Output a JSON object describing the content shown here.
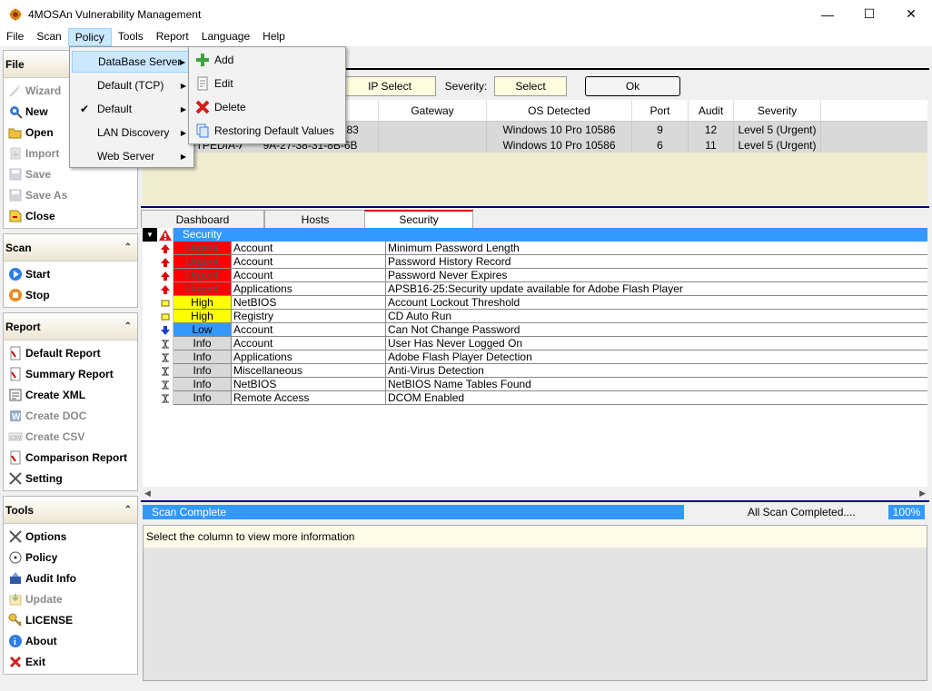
{
  "window": {
    "title": "4MOSAn Vulnerability Management"
  },
  "menubar": [
    "File",
    "Scan",
    "Policy",
    "Tools",
    "Report",
    "Language",
    "Help"
  ],
  "sidebar": {
    "file": {
      "title": "File",
      "items": [
        {
          "label": "Wizard",
          "icon": "wizard-icon",
          "enabled": false
        },
        {
          "label": "New",
          "icon": "new-icon",
          "enabled": true
        },
        {
          "label": "Open",
          "icon": "open-icon",
          "enabled": true
        },
        {
          "label": "Import",
          "icon": "import-icon",
          "enabled": false
        },
        {
          "label": "Save",
          "icon": "save-icon",
          "enabled": false
        },
        {
          "label": "Save As",
          "icon": "save-as-icon",
          "enabled": false
        },
        {
          "label": "Close",
          "icon": "close-file-icon",
          "enabled": true
        }
      ]
    },
    "scan": {
      "title": "Scan",
      "items": [
        {
          "label": "Start",
          "icon": "start-icon",
          "enabled": true
        },
        {
          "label": "Stop",
          "icon": "stop-icon",
          "enabled": true
        }
      ]
    },
    "report": {
      "title": "Report",
      "items": [
        {
          "label": "Default Report",
          "icon": "report-icon",
          "enabled": true
        },
        {
          "label": "Summary Report",
          "icon": "report-icon",
          "enabled": true
        },
        {
          "label": "Create XML",
          "icon": "xml-icon",
          "enabled": true
        },
        {
          "label": "Create DOC",
          "icon": "doc-icon",
          "enabled": false
        },
        {
          "label": "Create CSV",
          "icon": "csv-icon",
          "enabled": false
        },
        {
          "label": "Comparison Report",
          "icon": "report-icon",
          "enabled": true
        },
        {
          "label": "Setting",
          "icon": "setting-icon",
          "enabled": true
        }
      ]
    },
    "tools": {
      "title": "Tools",
      "items": [
        {
          "label": "Options",
          "icon": "options-icon",
          "enabled": true
        },
        {
          "label": "Policy",
          "icon": "policy-icon",
          "enabled": true
        },
        {
          "label": "Audit Info",
          "icon": "audit-icon",
          "enabled": true
        },
        {
          "label": "Update",
          "icon": "update-icon",
          "enabled": false
        },
        {
          "label": "LICENSE",
          "icon": "license-icon",
          "enabled": true
        },
        {
          "label": "About",
          "icon": "about-icon",
          "enabled": true
        },
        {
          "label": "Exit",
          "icon": "exit-icon",
          "enabled": true
        }
      ]
    }
  },
  "filter": {
    "ip_select": "IP Select",
    "severity_label": "Severity:",
    "select": "Select",
    "ok": "Ok"
  },
  "hosts": {
    "columns": [
      "",
      "",
      "Mac Address",
      "Gateway",
      "OS Detected",
      "Port",
      "Audit",
      "Severity"
    ],
    "rows": [
      {
        "c1": "",
        "c2": "",
        "mac": "D0-67-E5-0C-FF-83",
        "gw": "",
        "os": "Windows 10 Pro 10586",
        "port": "9",
        "audit": "12",
        "sev": "Level 5 (Urgent)"
      },
      {
        "c1": "0.0.9c2...",
        "c2": "SOFTPEDIA-AV",
        "mac": "9A-27-38-31-8B-6B",
        "gw": "",
        "os": "Windows 10 Pro 10586",
        "port": "6",
        "audit": "11",
        "sev": "Level 5 (Urgent)"
      }
    ]
  },
  "tabs": [
    "Dashboard",
    "Hosts",
    "Security"
  ],
  "security": {
    "header": "Security",
    "rows": [
      {
        "level": "Urgent",
        "cat": "Account",
        "desc": "Minimum Password Length"
      },
      {
        "level": "Urgent",
        "cat": "Account",
        "desc": "Password History Record"
      },
      {
        "level": "Urgent",
        "cat": "Account",
        "desc": "Password Never Expires"
      },
      {
        "level": "Urgent",
        "cat": "Applications",
        "desc": "APSB16-25:Security update available for Adobe Flash Player"
      },
      {
        "level": "High",
        "cat": "NetBIOS",
        "desc": "Account Lockout Threshold"
      },
      {
        "level": "High",
        "cat": "Registry",
        "desc": "CD Auto Run"
      },
      {
        "level": "Low",
        "cat": "Account",
        "desc": "Can Not Change Password"
      },
      {
        "level": "Info",
        "cat": "Account",
        "desc": "User Has Never Logged On"
      },
      {
        "level": "Info",
        "cat": "Applications",
        "desc": "Adobe Flash Player Detection"
      },
      {
        "level": "Info",
        "cat": "Miscellaneous",
        "desc": "Anti-Virus Detection"
      },
      {
        "level": "Info",
        "cat": "NetBIOS",
        "desc": "NetBIOS Name Tables Found"
      },
      {
        "level": "Info",
        "cat": "Remote Access",
        "desc": "DCOM Enabled"
      }
    ]
  },
  "level_colors": {
    "Urgent": "#ff0000",
    "High": "#ffff00",
    "Low": "#3399ff",
    "Info": "#d9d9d9"
  },
  "status": {
    "progress_text": "Scan Complete",
    "message": "All Scan Completed....",
    "percent": "100%",
    "progress": 1.0
  },
  "info": {
    "text": "Select the column to view more information"
  },
  "policy_menu": {
    "items": [
      {
        "label": "DataBase Server",
        "submenu": true,
        "checked": false,
        "highlight": true
      },
      {
        "label": "Default (TCP)",
        "submenu": true,
        "checked": false
      },
      {
        "label": "Default",
        "submenu": true,
        "checked": true
      },
      {
        "label": "LAN Discovery",
        "submenu": true,
        "checked": false
      },
      {
        "label": "Web Server",
        "submenu": true,
        "checked": false
      }
    ],
    "sub": [
      {
        "label": "Add",
        "icon": "add-icon"
      },
      {
        "label": "Edit",
        "icon": "edit-icon"
      },
      {
        "label": "Delete",
        "icon": "delete-icon"
      },
      {
        "label": "Restoring Default Values",
        "icon": "restore-icon"
      }
    ]
  }
}
